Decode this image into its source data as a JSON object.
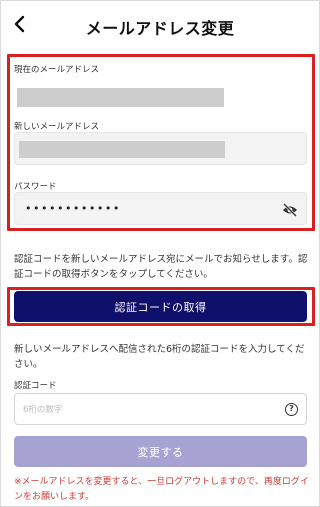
{
  "header": {
    "title": "メールアドレス変更",
    "back_icon": "chevron-left-icon"
  },
  "form": {
    "current_email_label": "現在のメールアドレス",
    "new_email_label": "新しいメールアドレス",
    "password_label": "パスワード",
    "password_value": "••••••••••••",
    "password_toggle_icon": "eye-off-icon"
  },
  "info": {
    "send_code_text": "認証コードを新しいメールアドレス宛にメールでお知らせします。認証コードの取得ボタンをタップしてください。",
    "enter_code_text": "新しいメールアドレスへ配信された6桁の認証コードを入力してください。"
  },
  "buttons": {
    "get_code": "認証コードの取得",
    "submit": "変更する"
  },
  "code": {
    "label": "認証コード",
    "placeholder": "6桁の数字",
    "help_icon": "question-circle-icon"
  },
  "warning": "※メールアドレスを変更すると、一旦ログアウトしますので、再度ログインをお願いします。",
  "colors": {
    "highlight": "#d7201f",
    "primary": "#0f0f6c",
    "submit_disabled": "#a6a3d2",
    "warning": "#d13a36"
  }
}
